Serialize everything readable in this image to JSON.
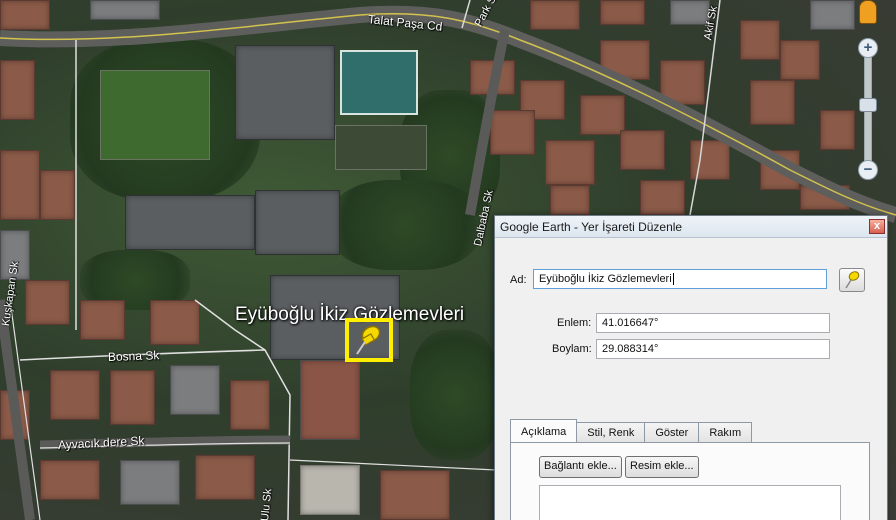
{
  "map": {
    "place_label": "Eyüboğlu İkiz Gözlemevleri",
    "roads": {
      "talat_pasa": "Talat Paşa Cd",
      "park": "Park Sk",
      "akif": "Akif Sk",
      "dalbaba": "Dalbaba Sk",
      "kuskapan": "Kuşkapan Sk",
      "bosna": "Bosna Sk",
      "ayvacikdere": "Ayvacık dere Sk",
      "ulu": "Ulu Sk"
    },
    "icons": [
      "pegman-icon",
      "zoom-in-icon",
      "zoom-out-icon",
      "placemark-pin-icon"
    ]
  },
  "dialog": {
    "title": "Google Earth - Yer İşareti Düzenle",
    "name_label": "Ad:",
    "name_value": "Eyüboğlu İkiz Gözlemevleri",
    "lat_label": "Enlem:",
    "lat_value": "41.016647°",
    "lon_label": "Boylam:",
    "lon_value": "29.088314°",
    "tabs": [
      {
        "label": "Açıklama"
      },
      {
        "label": "Stil, Renk"
      },
      {
        "label": "Göster"
      },
      {
        "label": "Rakım"
      }
    ],
    "add_link_label": "Bağlantı ekle...",
    "add_image_label": "Resim ekle...",
    "close_label": "x"
  },
  "colors": {
    "pin_highlight": "#ffee00",
    "road_line": "#e8d44a"
  }
}
